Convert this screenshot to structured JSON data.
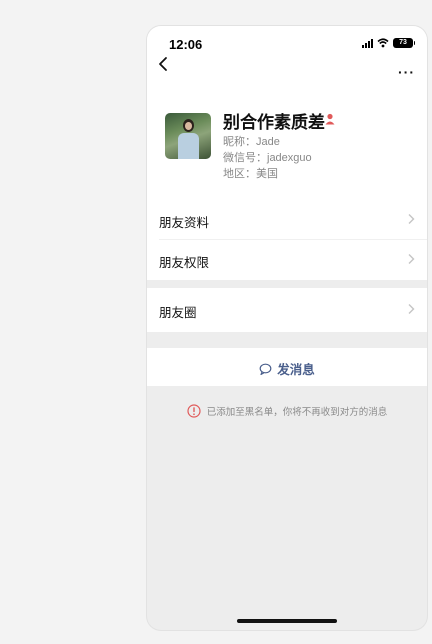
{
  "status_bar": {
    "time": "12:06",
    "battery": "73"
  },
  "profile": {
    "name": "别合作素质差",
    "nickname_line": "昵称：Jade",
    "wechat_id_line": "微信号：jadexguo",
    "region_line": "地区：美国"
  },
  "menu": {
    "friend_info": "朋友资料",
    "friend_permissions": "朋友权限",
    "moments": "朋友圈"
  },
  "actions": {
    "send_message": "发消息"
  },
  "notice": {
    "blocked_text": "已添加至黑名单，你将不再收到对方的消息"
  },
  "colors": {
    "accent_link": "#4a5f8c",
    "warning_red": "#e05a5a"
  }
}
